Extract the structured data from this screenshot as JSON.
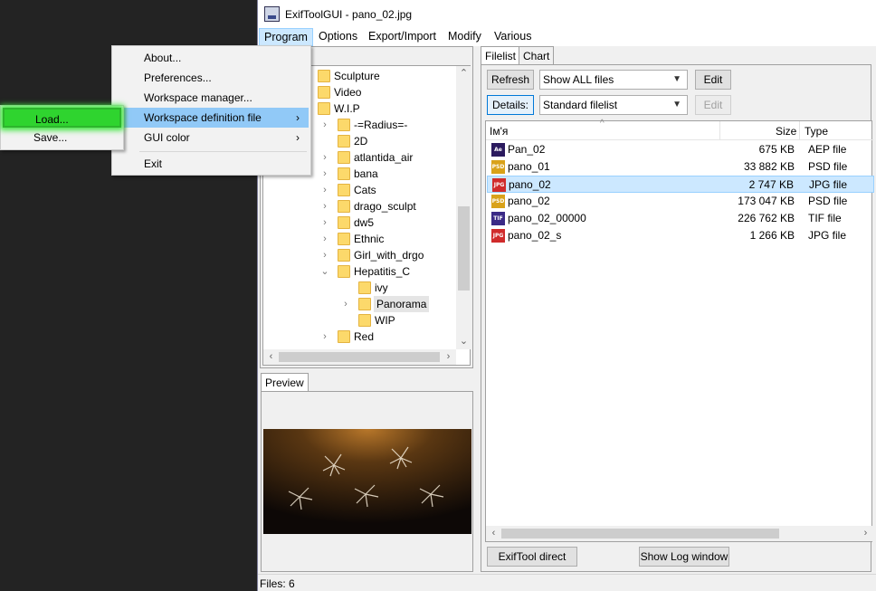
{
  "window": {
    "title": "ExifToolGUI - pano_02.jpg",
    "menus": [
      "Program",
      "Options",
      "Export/Import",
      "Modify",
      "Various"
    ]
  },
  "program_menu": {
    "items": [
      "About...",
      "Preferences...",
      "Workspace manager...",
      "Workspace definition file",
      "GUI color",
      "Exit"
    ]
  },
  "workspace_submenu": {
    "items": [
      "Load...",
      "Save..."
    ]
  },
  "folder_tree": {
    "items": [
      "Sculpture",
      "Video",
      "W.I.P",
      "-=Radius=-",
      "2D",
      "atlantida_air",
      "bana",
      "Cats",
      "drago_sculpt",
      "dw5",
      "Ethnic",
      "Girl_with_drgo",
      "Hepatitis_C",
      "ivy",
      "Panorama",
      "WIP",
      "Red"
    ]
  },
  "preview": {
    "tab": "Preview"
  },
  "tabs": {
    "filelist": "Filelist",
    "chart": "Chart"
  },
  "toolbar": {
    "refresh": "Refresh",
    "filter": "Show ALL files",
    "edit1": "Edit",
    "details": "Details:",
    "view": "Standard filelist",
    "edit2": "Edit"
  },
  "columns": {
    "name": "Ім'я",
    "size": "Size",
    "type": "Type"
  },
  "files": [
    {
      "icon": "Ae",
      "icon_color": "#2b1a5e",
      "name": "Pan_02",
      "size": "675 KB",
      "type": "AEP file",
      "selected": false
    },
    {
      "icon": "PSD",
      "icon_color": "#d9a21a",
      "name": "pano_01",
      "size": "33 882 KB",
      "type": "PSD file",
      "selected": false
    },
    {
      "icon": "JPG",
      "icon_color": "#d02b2b",
      "name": "pano_02",
      "size": "2 747 KB",
      "type": "JPG file",
      "selected": true
    },
    {
      "icon": "PSD",
      "icon_color": "#d9a21a",
      "name": "pano_02",
      "size": "173 047 KB",
      "type": "PSD file",
      "selected": false
    },
    {
      "icon": "TIF",
      "icon_color": "#3b2a86",
      "name": "pano_02_00000",
      "size": "226 762 KB",
      "type": "TIF file",
      "selected": false
    },
    {
      "icon": "JPG",
      "icon_color": "#d02b2b",
      "name": "pano_02_s",
      "size": "1 266 KB",
      "type": "JPG file",
      "selected": false
    }
  ],
  "bottom_buttons": {
    "exiftool_direct": "ExifTool direct",
    "show_log": "Show Log window"
  },
  "status": {
    "files": "Files: 6"
  }
}
